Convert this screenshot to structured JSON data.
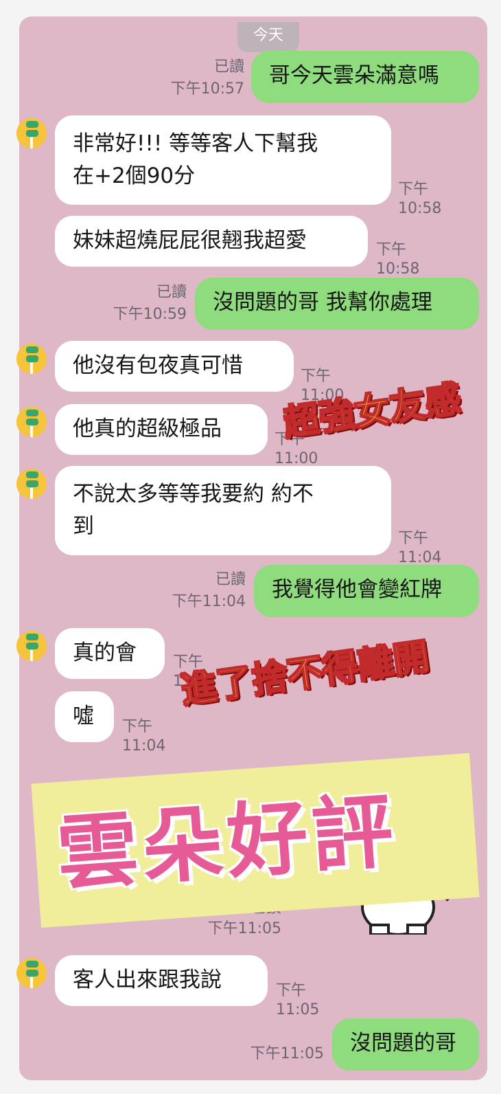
{
  "date_pill": "今天",
  "messages": [
    {
      "side": "out",
      "text": "哥今天雲朵滿意嗎",
      "read": "已讀",
      "time": "下午10:57"
    },
    {
      "side": "in",
      "line1": "非常好!!! 等等客人下幫我",
      "line2": "在+2個90分",
      "time": "下午10:58"
    },
    {
      "side": "in",
      "text": "妹妹超燒屁屁很翹我超愛",
      "time": "下午10:58"
    },
    {
      "side": "out",
      "text": "沒問題的哥 我幫你處理",
      "read": "已讀",
      "time": "下午10:59"
    },
    {
      "side": "in",
      "text": "他沒有包夜真可惜",
      "time": "下午11:00"
    },
    {
      "side": "in",
      "text": "他真的超級極品",
      "time": "下午11:00"
    },
    {
      "side": "in",
      "line1": "不說太多等等我要約 約不",
      "line2": "到",
      "time": "下午11:04"
    },
    {
      "side": "out",
      "text": "我覺得他會變紅牌",
      "read": "已讀",
      "time": "下午11:04"
    },
    {
      "side": "in",
      "text": "真的會",
      "time": "下午11:04"
    },
    {
      "side": "in",
      "text": "噓",
      "time": "下午11:04"
    },
    {
      "side": "out",
      "read": "已讀",
      "time": "下午11:05"
    },
    {
      "side": "in",
      "text": "客人出來跟我說",
      "time": "下午11:05"
    },
    {
      "side": "out",
      "text": "沒問題的哥",
      "time": "下午11:05"
    }
  ],
  "overlays": {
    "label_1": "超強女友感",
    "label_2": "進了捨不得離開",
    "banner": "雲朵好評"
  },
  "colors": {
    "background": "#dfb8c8",
    "outgoing_bubble": "#8fdc7e",
    "incoming_bubble": "#ffffff",
    "banner_bg": "#f0ee9a",
    "banner_text": "#e65b96"
  },
  "icons": [
    "contact-avatar-icon",
    "sticker-character-icon"
  ]
}
